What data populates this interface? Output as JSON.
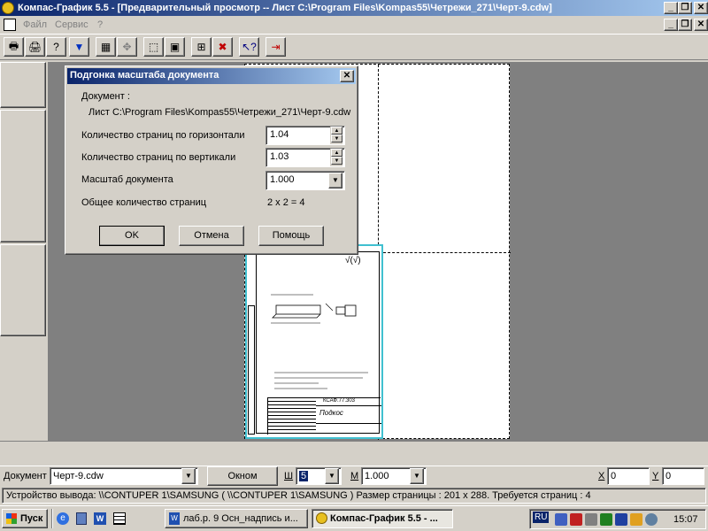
{
  "window": {
    "title": "Компас-График 5.5 - [Предварительный просмотр -- Лист C:\\Program Files\\Kompas55\\Четрежи_271\\Черт-9.cdw]"
  },
  "menu": {
    "items": [
      "Файл",
      "Сервис",
      "?"
    ]
  },
  "toolbar": {
    "icons": [
      "printer-icon",
      "printer-setup-icon",
      "help-cursor-icon",
      "filter-icon",
      "arrange-icon",
      "move-icon",
      "fit-page-icon",
      "fit-sheet-icon",
      "grid-icon",
      "delete-icon",
      "help-icon",
      "exit-icon"
    ]
  },
  "dialog": {
    "title": "Подгонка масштаба документа",
    "doc_label": "Документ :",
    "doc_path": "Лист C:\\Program Files\\Kompas55\\Четрежи_271\\Черт-9.cdw",
    "horiz_label": "Количество страниц по горизонтали",
    "horiz_value": "1.04",
    "vert_label": "Количество страниц по вертикали",
    "vert_value": "1.03",
    "scale_label": "Масштаб документа",
    "scale_value": "1.000",
    "total_label": "Общее количество страниц",
    "total_value": "2 х 2 = 4",
    "ok": "OK",
    "cancel": "Отмена",
    "help": "Помощь"
  },
  "drawing": {
    "title_text": "Подкос",
    "code_text": "КСАФ.77.303",
    "roughness": "√(√)"
  },
  "bottombar": {
    "doc_label": "Документ",
    "doc_value": "Черт-9.cdw",
    "window_btn": "Окном",
    "w_label": "Ш",
    "w_value": "5",
    "m_label": "М",
    "m_value": "1.000",
    "x_label": "X",
    "x_value": "0",
    "y_label": "Y",
    "y_value": "0"
  },
  "status": {
    "text": "Устройство вывода: \\\\CONTUPER 1\\SAMSUNG ( \\\\CONTUPER 1\\SAMSUNG )  Размер страницы : 201 х 288. Требуется страниц : 4"
  },
  "taskbar": {
    "start": "Пуск",
    "task1": "лаб.р. 9 Осн_надпись и...",
    "task2": "Компас-График 5.5 - ...",
    "lang": "RU",
    "clock": "15:07"
  }
}
